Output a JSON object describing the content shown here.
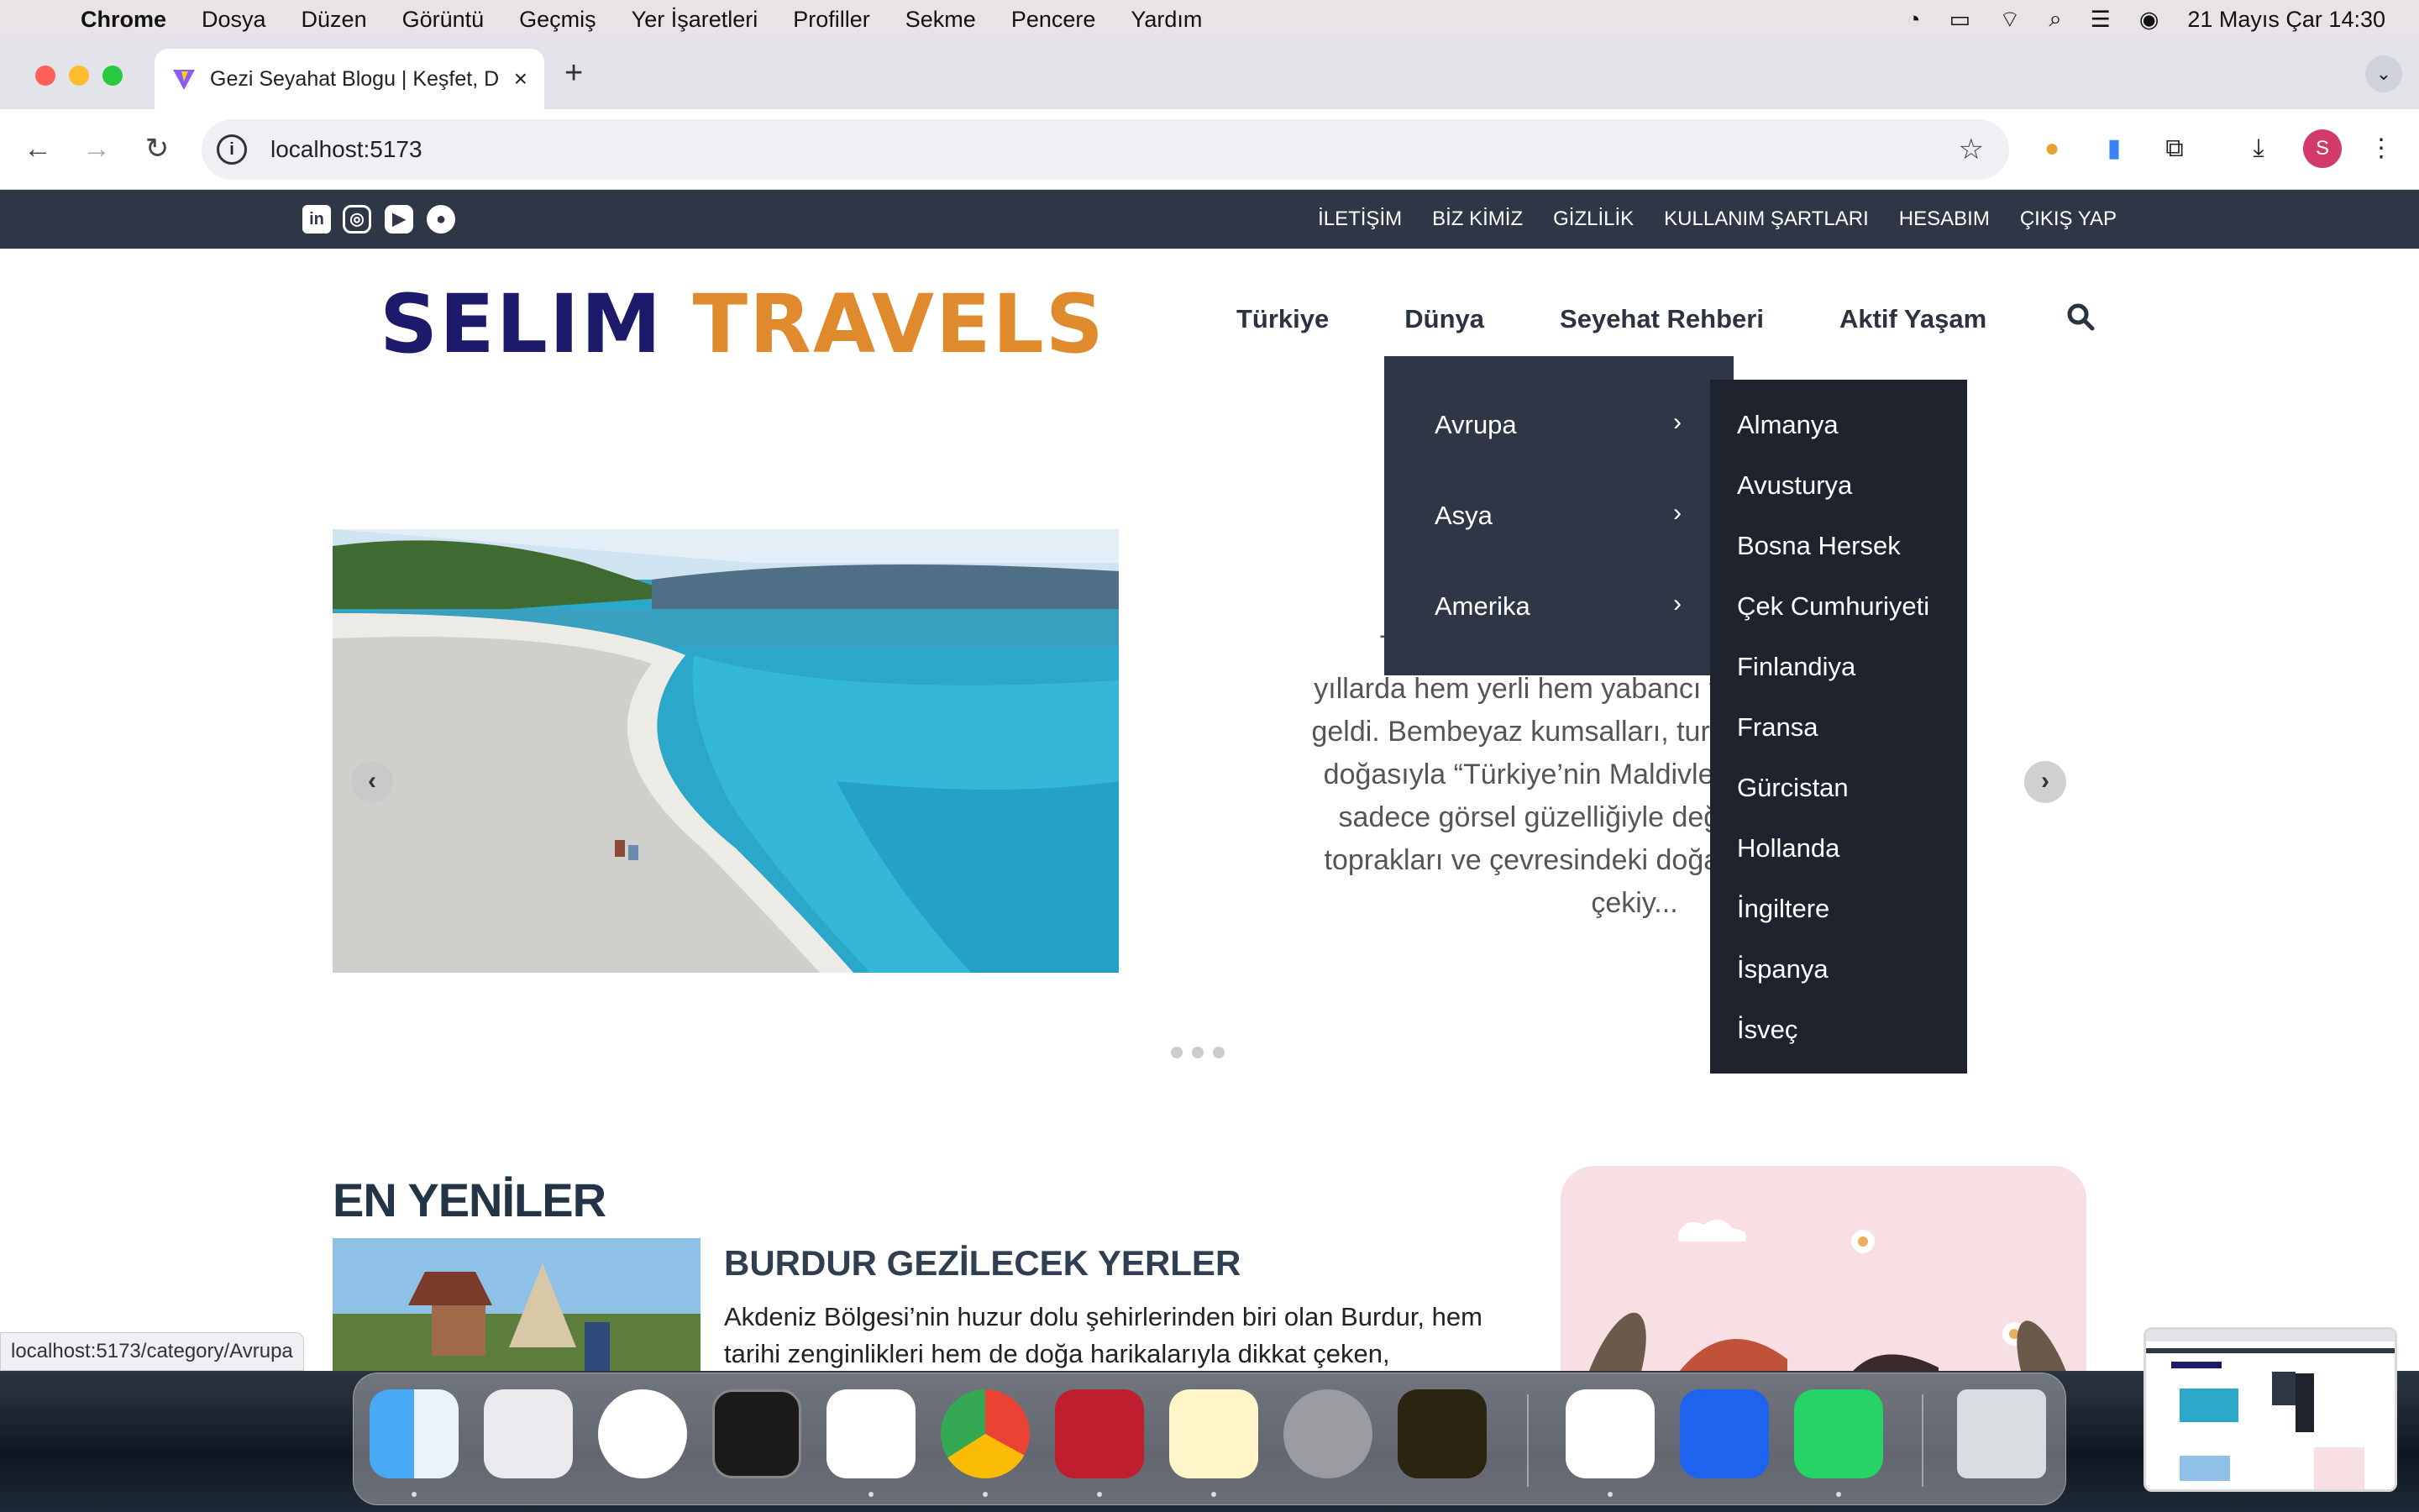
{
  "menubar": {
    "app": "Chrome",
    "items": [
      "Dosya",
      "Düzen",
      "Görüntü",
      "Geçmiş",
      "Yer İşaretleri",
      "Profiller",
      "Sekme",
      "Pencere",
      "Yardım"
    ],
    "datetime": "21 Mayıs Çar  14:30"
  },
  "browser": {
    "tab_title": "Gezi Seyahat Blogu | Keşfet, D",
    "url": "localhost:5173",
    "avatar_letter": "S",
    "status_url": "localhost:5173/category/Avrupa"
  },
  "site": {
    "top_links": [
      "İLETİŞİM",
      "BİZ KİMİZ",
      "GİZLİLİK",
      "KULLANIM ŞARTLARI",
      "HESABIM",
      "ÇIKIŞ YAP"
    ],
    "logo_a": "SELIM",
    "logo_b": "TRAVELS",
    "nav": [
      "Türkiye",
      "Dünya",
      "Seyehat Rehberi",
      "Aktif Yaşam"
    ],
    "dropdown_regions": [
      "Avrupa",
      "Asya",
      "Amerika"
    ],
    "dropdown_countries": [
      "Almanya",
      "Avusturya",
      "Bosna Hersek",
      "Çek Cumhuriyeti",
      "Finlandiya",
      "Fransa",
      "Gürcistan",
      "Hollanda",
      "İngiltere",
      "İspanya",
      "İsveç"
    ],
    "hero_lines": [
      "Türkiye’ni                                           son",
      "yıllarda hem yerli hem yabancı tu                        ne",
      "geldi. Bembeyaz kumsalları, turku                       siz",
      "doğasıyla “Türkiye’nin Maldivleri”                       a,",
      "sadece görsel güzelliğiyle değil,                       ı",
      "toprakları ve çevresindeki doğal ze                  kat",
      "çekiy..."
    ],
    "latest_title": "EN YENİLER",
    "post_title": "BURDUR GEZİLECEK YERLER",
    "post_text": "Akdeniz Bölgesi’nin huzur dolu şehirlerinden biri olan Burdur, hem tarihi zenginlikleri hem de doğa harikalarıyla dikkat çeken,"
  },
  "colors": {
    "topbar": "#2f3645",
    "logo_dark": "#1d1a6b",
    "logo_orange": "#e08a2e",
    "dropdown": "#2f3645",
    "submenu": "#1f232d"
  },
  "icons": {
    "dock": [
      "finder-icon",
      "launchpad-icon",
      "safari-icon",
      "terminal-icon",
      "vscode-icon",
      "chrome-icon",
      "filezilla-icon",
      "notes-icon",
      "system-settings-icon",
      "sequel-icon",
      "mongodb-icon",
      "docker-icon",
      "whatsapp-icon",
      "trash-icon"
    ]
  }
}
